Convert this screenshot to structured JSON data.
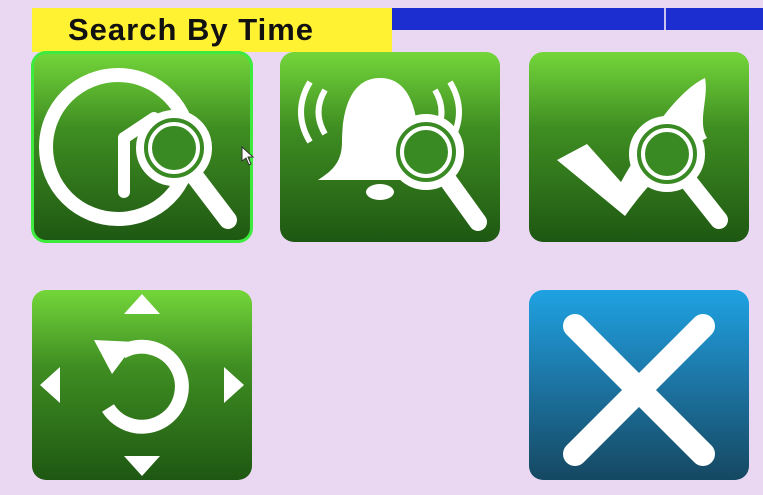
{
  "header": {
    "title": "Search By Time"
  },
  "colors": {
    "background": "#ead8f3",
    "title_bg": "#fff233",
    "top_bar": "#1c2ecf",
    "tile_green": "#3f8e22",
    "tile_blue": "#1d78a8",
    "selection": "#3eea3e"
  },
  "tiles": [
    {
      "icon": "clock-search-icon",
      "selected": true
    },
    {
      "icon": "alarm-bell-search-icon",
      "selected": false
    },
    {
      "icon": "checkmark-search-icon",
      "selected": false
    },
    {
      "icon": "rotate-navigation-icon",
      "selected": false
    },
    {
      "icon": "close-x-icon",
      "selected": false
    }
  ]
}
